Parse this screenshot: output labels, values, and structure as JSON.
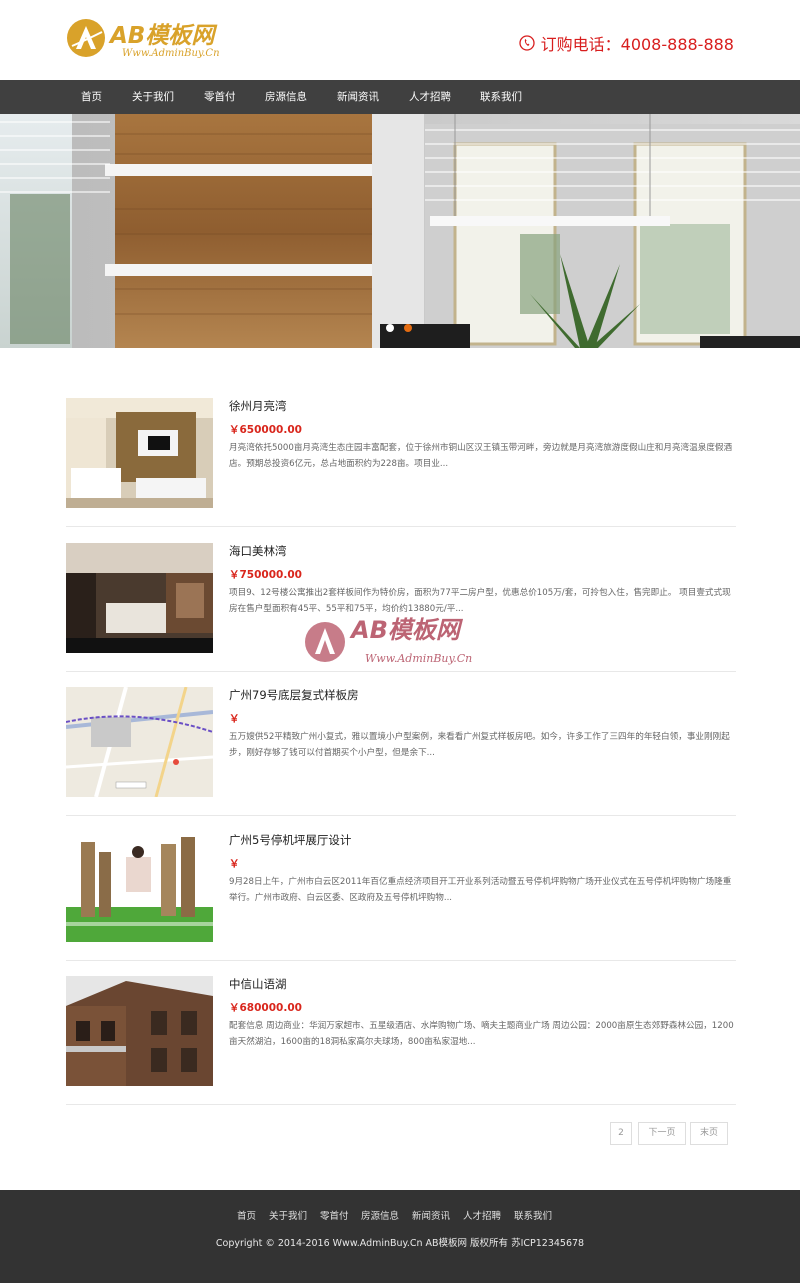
{
  "header": {
    "logo_text": "AB模板网",
    "logo_sub": "Www.AdminBuy.Cn",
    "phone": "订购电话：4008-888-888"
  },
  "nav": {
    "items": [
      "首页",
      "关于我们",
      "零首付",
      "房源信息",
      "新闻资讯",
      "人才招聘",
      "联系我们"
    ]
  },
  "listings": [
    {
      "title": "徐州月亮湾",
      "price": "￥650000.00",
      "desc": "月亮湾依托5000亩月亮湾生态庄园丰富配套，位于徐州市铜山区汉王镇玉带河畔，旁边就是月亮湾旅游度假山庄和月亮湾温泉度假酒店。预期总投资6亿元，总占地面积约为228亩。项目业..."
    },
    {
      "title": "海口美林湾",
      "price": "￥750000.00",
      "desc": "项目9、12号楼公寓推出2套样板间作为特价房，面积为77平二房户型，优惠总价105万/套，可拎包入住，售完即止。 项目壹式式现房在售户型面积有45平、55平和75平，均价约13880元/平..."
    },
    {
      "title": "广州79号底层复式样板房",
      "price": "￥",
      "desc": "五万嫂供52平精致广州小复式，雅以置境小户型案例，来看看广州复式样板房吧。如今，许多工作了三四年的年轻白领，事业刚刚起步，刚好存够了钱可以付首期买个小户型，但是余下..."
    },
    {
      "title": "广州5号停机坪展厅设计",
      "price": "￥",
      "desc": "9月28日上午，广州市白云区2011年百亿重点经济项目开工开业系列活动暨五号停机坪购物广场开业仪式在五号停机坪购物广场隆重举行。广州市政府、白云区委、区政府及五号停机坪购物..."
    },
    {
      "title": "中信山语湖",
      "price": "￥680000.00",
      "desc": "配套信息 周边商业：华润万家超市、五星级酒店、水岸购物广场、嘀夫主题商业广场 周边公园：2000亩原生态郊野森林公园，1200亩天然湖泊，1600亩的18洞私家高尔夫球场，800亩私家湿地..."
    }
  ],
  "pager": {
    "page": "2",
    "next": "下一页",
    "last": "末页"
  },
  "watermark": {
    "text": "AB模板网",
    "sub": "Www.AdminBuy.Cn"
  },
  "footer": {
    "links": [
      "首页",
      "关于我们",
      "零首付",
      "房源信息",
      "新闻资讯",
      "人才招聘",
      "联系我们"
    ],
    "copyright": "Copyright © 2014-2016 Www.AdminBuy.Cn AB模板网 版权所有  苏ICP12345678"
  },
  "colors": {
    "brand": "#d9a22a",
    "nav_bg": "#404040",
    "price": "#d9261c",
    "footer_bg": "#333333",
    "banner_dot_active": "#e46c12"
  }
}
